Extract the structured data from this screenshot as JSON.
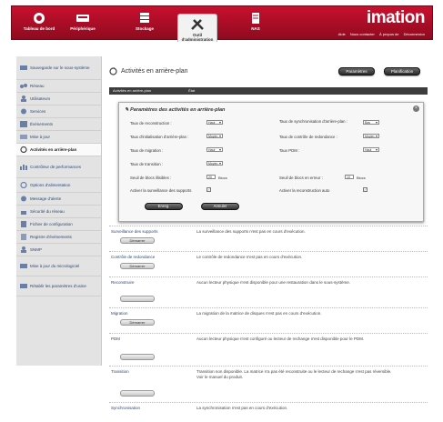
{
  "nav": {
    "items": [
      {
        "label": "Tableau de bord",
        "icon": "dashboard-icon"
      },
      {
        "label": "Périphérique",
        "icon": "device-icon"
      },
      {
        "label": "Stockage",
        "icon": "storage-icon"
      },
      {
        "label": "Outil d'administration",
        "icon": "tools-icon",
        "active": true
      },
      {
        "label": "NAS",
        "icon": "nas-icon"
      }
    ],
    "brand": "imation",
    "links": [
      "Aide",
      "Nous contacter",
      "À propos de",
      "Déconnexion"
    ]
  },
  "sidebar": {
    "items": [
      {
        "label": "Sauvegarde sur le sous-système",
        "icon": "backup-icon"
      },
      {
        "label": "Réseau",
        "icon": "network-icon"
      },
      {
        "label": "Utilisateurs",
        "icon": "users-icon"
      },
      {
        "label": "Services",
        "icon": "services-icon"
      },
      {
        "label": "Événements",
        "icon": "events-icon"
      },
      {
        "label": "Mise à jour",
        "icon": "update-icon"
      },
      {
        "label": "Activités en arrière-plan",
        "icon": "background-activity-icon",
        "active": true
      },
      {
        "label": "Contrôleur de performances",
        "icon": "performance-icon"
      },
      {
        "label": "Options d'alimentation",
        "icon": "power-icon"
      },
      {
        "label": "Message d'alerte",
        "icon": "alert-icon"
      },
      {
        "label": "Sécurité du réseau",
        "icon": "security-icon"
      },
      {
        "label": "Fichier de configuration",
        "icon": "config-file-icon"
      },
      {
        "label": "Registre d'événements",
        "icon": "event-log-icon"
      },
      {
        "label": "SNMP",
        "icon": "snmp-icon"
      },
      {
        "label": "Mise à jour du micrologiciel",
        "icon": "firmware-icon"
      },
      {
        "label": "Rétablir les paramètres d'usine",
        "icon": "factory-reset-icon"
      }
    ]
  },
  "main": {
    "title": "Activités en arrière-plan",
    "buttons": {
      "settings": "Paramètres",
      "schedule": "Planification"
    },
    "subbar": [
      "Activités en arrière-plan",
      "État"
    ]
  },
  "popup": {
    "title": "Paramètres des activités en arrière-plan",
    "close": "×",
    "left": [
      {
        "label": "Taux de reconstruction :",
        "value": "Haut"
      },
      {
        "label": "Taux d'initialisation d'arrière-plan :",
        "value": "Moyen"
      },
      {
        "label": "Taux de migration :",
        "value": "Haut"
      },
      {
        "label": "Taux de transition :",
        "value": "Moyen"
      }
    ],
    "right": [
      {
        "label": "Taux de synchronisation d'arrière-plan :",
        "value": "Bas"
      },
      {
        "label": "Taux de contrôle de redondance :",
        "value": "Moyen"
      },
      {
        "label": "Taux PDM :",
        "value": "Haut"
      }
    ],
    "threshold_left": {
      "label": "Seuil de blocs illisibles :",
      "value": "20",
      "unit": "Blocs"
    },
    "threshold_right": {
      "label": "Seuil de blocs en erreur :",
      "value": "10",
      "unit": "Blocs"
    },
    "check_left": "Activer la surveillance des supports",
    "check_right": "Activer la reconstruction auto",
    "check_mark": "✓",
    "save": "Enreg.",
    "cancel": "Annuler"
  },
  "rows": [
    {
      "name": "Surveillance des supports",
      "text": "La surveillance des supports n'est pas en cours d'exécution.",
      "button": "Démarrer"
    },
    {
      "name": "Contrôle de redondance",
      "text": "Le contrôle de redondance n'est pas en cours d'exécution.",
      "button": "Démarrer"
    },
    {
      "name": "Reconstruire",
      "text": "Aucun lecteur physique n'est disponible pour une restauration dans le sous-système.",
      "button": ""
    },
    {
      "name": "Migration",
      "text": "La migration de la matrice de disques n'est pas en cours d'exécution.",
      "button": "Démarrer"
    },
    {
      "name": "PDM",
      "text": "Aucun lecteur physique n'est configuré ou lecteur de rechange n'est disponible pour le PDM.",
      "button": ""
    },
    {
      "name": "Transition",
      "text": "Transition non disponible. La matrice n'a pas été reconstruite ou le lecteur de rechange n'est pas réversible. Voir le manuel du produit.",
      "button": ""
    },
    {
      "name": "Synchronisation",
      "text": "La synchronisation n'est pas en cours d'exécution.",
      "button": ""
    }
  ],
  "colors": {
    "nav": "#b00e27",
    "sidebar": "#e3e3e3",
    "dark_button": "#333333",
    "link": "#2b4a7a"
  }
}
